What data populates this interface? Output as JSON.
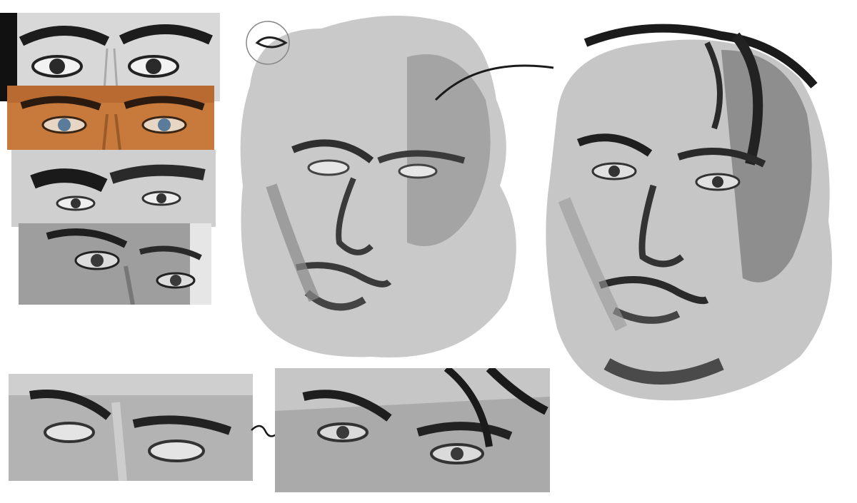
{
  "artwork": {
    "subject": "face-study-sheet",
    "reference_photos": [
      {
        "name": "eyes-reference-1",
        "tone": "grayscale"
      },
      {
        "name": "eyes-reference-2",
        "tone": "color"
      },
      {
        "name": "eyes-reference-3",
        "tone": "grayscale"
      },
      {
        "name": "eyes-reference-4",
        "tone": "grayscale"
      }
    ],
    "paintings": [
      {
        "name": "sketch-stage",
        "tone": "grayscale"
      },
      {
        "name": "finished-stage",
        "tone": "grayscale"
      },
      {
        "name": "eyes-detail-before",
        "tone": "grayscale"
      },
      {
        "name": "eyes-detail-after",
        "tone": "grayscale"
      }
    ],
    "colors": {
      "background": "#ffffff",
      "paint_light": "#c9c9c9",
      "paint_mid": "#8f8f8f",
      "paint_dark": "#3a3a3a",
      "skin_orange": "#c77a3c",
      "iris_blue": "#5a7b9a"
    }
  }
}
